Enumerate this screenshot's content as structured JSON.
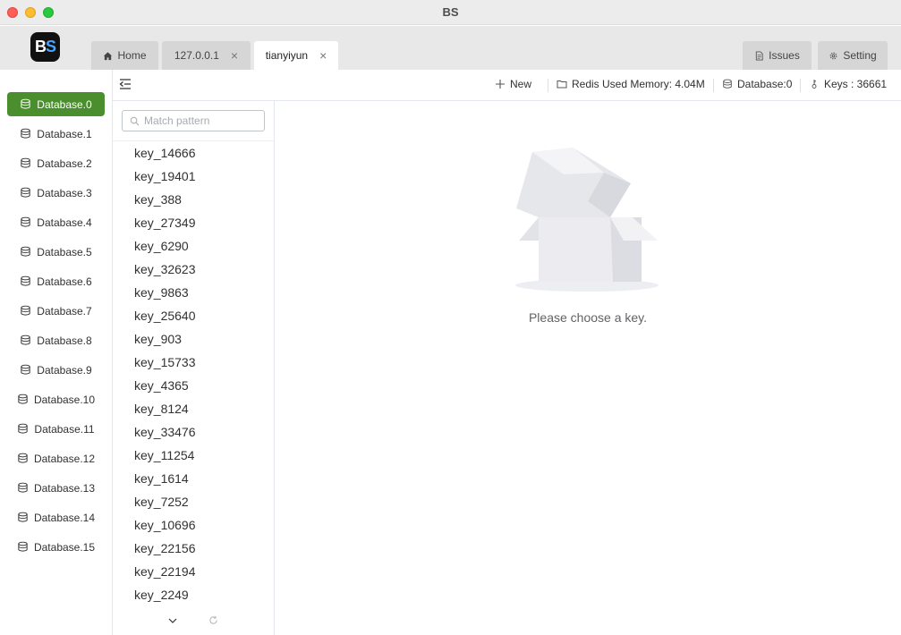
{
  "window": {
    "title": "BS"
  },
  "tabs": [
    {
      "label": "Home",
      "icon": "home-icon"
    },
    {
      "label": "127.0.0.1",
      "closable": true
    },
    {
      "label": "tianyiyun",
      "closable": true,
      "active": true
    }
  ],
  "right_tabs": [
    {
      "label": "Issues",
      "icon": "document-icon"
    },
    {
      "label": "Setting",
      "icon": "gear-icon"
    }
  ],
  "close_glyph": "×",
  "databases": [
    {
      "label": "Database.0",
      "active": true
    },
    {
      "label": "Database.1"
    },
    {
      "label": "Database.2"
    },
    {
      "label": "Database.3"
    },
    {
      "label": "Database.4"
    },
    {
      "label": "Database.5"
    },
    {
      "label": "Database.6"
    },
    {
      "label": "Database.7"
    },
    {
      "label": "Database.8"
    },
    {
      "label": "Database.9"
    },
    {
      "label": "Database.10"
    },
    {
      "label": "Database.11"
    },
    {
      "label": "Database.12"
    },
    {
      "label": "Database.13"
    },
    {
      "label": "Database.14"
    },
    {
      "label": "Database.15"
    }
  ],
  "toolbar": {
    "new_label": "New",
    "memory_label": "Redis Used Memory: 4.04M",
    "database_label": "Database:0",
    "keys_label": "Keys : 36661"
  },
  "search": {
    "placeholder": "Match pattern",
    "value": ""
  },
  "keys": [
    "key_14666",
    "key_19401",
    "key_388",
    "key_27349",
    "key_6290",
    "key_32623",
    "key_9863",
    "key_25640",
    "key_903",
    "key_15733",
    "key_4365",
    "key_8124",
    "key_33476",
    "key_11254",
    "key_1614",
    "key_7252",
    "key_10696",
    "key_22156",
    "key_22194",
    "key_2249"
  ],
  "empty_state": {
    "text": "Please choose a key."
  },
  "colors": {
    "accent": "#4b8e2e",
    "tab_inactive": "#d6d6d6",
    "border": "#e4e7ed"
  }
}
